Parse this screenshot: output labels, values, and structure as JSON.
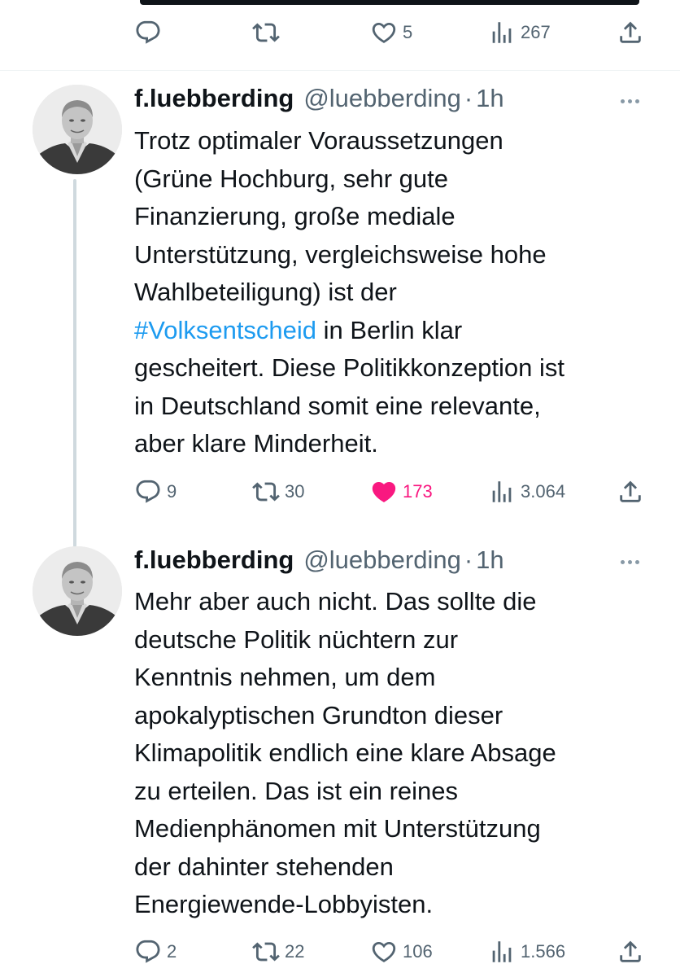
{
  "previous_tweet": {
    "actions": {
      "reply": "",
      "retweet": "",
      "like": "5",
      "views": "267"
    }
  },
  "tweets": [
    {
      "display_name": "f.luebberding",
      "handle": "@luebberding",
      "separator": "·",
      "time": "1h",
      "text_lines": [
        "Trotz optimaler Voraussetzungen",
        "(Grüne Hochburg, sehr gute",
        "Finanzierung, große mediale",
        "Unterstützung, vergleichsweise hohe",
        "Wahlbeteiligung) ist der"
      ],
      "hashtag": "#Volksentscheid",
      "hashtag_suffix": " in Berlin klar",
      "text_lines_after": [
        "gescheitert. Diese Politikkonzeption ist",
        "in Deutschland somit eine relevante,",
        "aber klare Minderheit."
      ],
      "actions": {
        "reply": "9",
        "retweet": "30",
        "like": "173",
        "views": "3.064"
      },
      "liked": true
    },
    {
      "display_name": "f.luebberding",
      "handle": "@luebberding",
      "separator": "·",
      "time": "1h",
      "text_lines": [
        "Mehr aber auch nicht. Das sollte die",
        "deutsche Politik nüchtern zur",
        "Kenntnis nehmen, um dem",
        "apokalyptischen Grundton dieser",
        "Klimapolitik endlich eine klare Absage",
        "zu erteilen. Das ist ein reines",
        "Medienphänomen mit Unterstützung",
        "der dahinter stehenden",
        "Energiewende-Lobbyisten."
      ],
      "actions": {
        "reply": "2",
        "retweet": "22",
        "like": "106",
        "views": "1.566"
      },
      "liked": false
    }
  ],
  "icons": {
    "reply": "reply-icon",
    "retweet": "retweet-icon",
    "like": "heart-icon",
    "views": "views-icon",
    "share": "share-icon",
    "more": "more-icon"
  },
  "colors": {
    "text": "#0f1419",
    "secondary": "#536471",
    "link": "#1d9bf0",
    "like_active": "#f91880",
    "thread_line": "#cfd9de"
  }
}
